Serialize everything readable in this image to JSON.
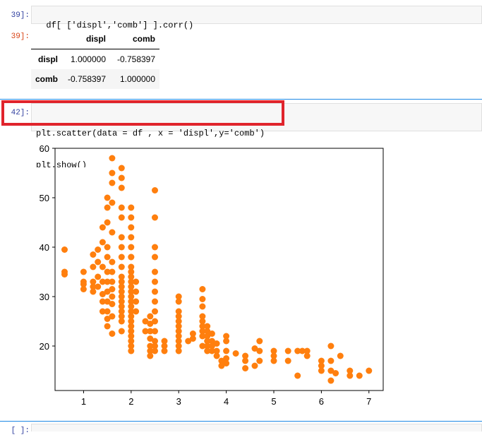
{
  "cells": [
    {
      "in_prompt": "39]:",
      "code": "df[ ['displ','comb'] ].corr()",
      "out_prompt": "39]:"
    },
    {
      "in_prompt": "42]:",
      "code_line1": "plt.scatter(data = df , x = 'displ',y='comb')",
      "code_line2": "plt.show()"
    },
    {
      "in_prompt": "[ ]:"
    }
  ],
  "corr_table": {
    "columns": [
      "displ",
      "comb"
    ],
    "rows": [
      {
        "index": "displ",
        "values": [
          "1.000000",
          "-0.758397"
        ]
      },
      {
        "index": "comb",
        "values": [
          "-0.758397",
          "1.000000"
        ]
      }
    ]
  },
  "colors": {
    "marker": "#ff7f0e",
    "highlight_box": "#e0242c",
    "selection_line": "#1e88e5"
  },
  "chart_data": {
    "type": "scatter",
    "title": "",
    "xlabel": "",
    "ylabel": "",
    "xlim": [
      0.4,
      7.3
    ],
    "ylim": [
      11,
      60
    ],
    "xticks": [
      1,
      2,
      3,
      4,
      5,
      6,
      7
    ],
    "yticks": [
      20,
      30,
      40,
      50,
      60
    ],
    "x": [
      0.6,
      0.6,
      0.6,
      1.0,
      1.0,
      1.0,
      1.0,
      1.2,
      1.2,
      1.2,
      1.2,
      1.2,
      1.3,
      1.3,
      1.3,
      1.3,
      1.4,
      1.4,
      1.4,
      1.4,
      1.4,
      1.4,
      1.4,
      1.5,
      1.5,
      1.5,
      1.5,
      1.5,
      1.5,
      1.5,
      1.5,
      1.5,
      1.5,
      1.5,
      1.5,
      1.6,
      1.6,
      1.6,
      1.6,
      1.6,
      1.6,
      1.6,
      1.6,
      1.6,
      1.6,
      1.6,
      1.6,
      1.6,
      1.8,
      1.8,
      1.8,
      1.8,
      1.8,
      1.8,
      1.8,
      1.8,
      1.8,
      1.8,
      1.8,
      1.8,
      1.8,
      1.8,
      1.8,
      1.8,
      1.8,
      1.8,
      1.8,
      1.8,
      2.0,
      2.0,
      2.0,
      2.0,
      2.0,
      2.0,
      2.0,
      2.0,
      2.0,
      2.0,
      2.0,
      2.0,
      2.0,
      2.0,
      2.0,
      2.0,
      2.0,
      2.0,
      2.0,
      2.0,
      2.0,
      2.0,
      2.0,
      2.0,
      2.0,
      2.1,
      2.1,
      2.1,
      2.1,
      2.3,
      2.3,
      2.4,
      2.4,
      2.4,
      2.4,
      2.4,
      2.4,
      2.4,
      2.5,
      2.5,
      2.5,
      2.5,
      2.5,
      2.5,
      2.5,
      2.5,
      2.5,
      2.5,
      2.5,
      2.5,
      2.5,
      2.5,
      2.7,
      2.7,
      2.7,
      3.0,
      3.0,
      3.0,
      3.0,
      3.0,
      3.0,
      3.0,
      3.0,
      3.0,
      3.0,
      3.0,
      3.2,
      3.3,
      3.3,
      3.5,
      3.5,
      3.5,
      3.5,
      3.5,
      3.5,
      3.5,
      3.5,
      3.5,
      3.6,
      3.6,
      3.6,
      3.6,
      3.6,
      3.6,
      3.7,
      3.7,
      3.7,
      3.7,
      3.8,
      3.8,
      3.8,
      3.9,
      3.9,
      4.0,
      4.0,
      4.0,
      4.0,
      4.0,
      4.2,
      4.4,
      4.4,
      4.4,
      4.6,
      4.6,
      4.7,
      4.7,
      4.7,
      5.0,
      5.0,
      5.0,
      5.3,
      5.3,
      5.5,
      5.5,
      5.6,
      5.7,
      5.7,
      6.0,
      6.0,
      6.0,
      6.2,
      6.2,
      6.2,
      6.2,
      6.3,
      6.4,
      6.6,
      6.6,
      6.8,
      7.0
    ],
    "y": [
      39.5,
      35.0,
      34.5,
      35.0,
      33.0,
      31.5,
      32.5,
      38.5,
      36.0,
      33.0,
      32.0,
      31.0,
      39.5,
      37.0,
      34.0,
      32.0,
      44.0,
      41.0,
      36.0,
      33.0,
      30.5,
      29.0,
      27.0,
      50.0,
      48.0,
      45.0,
      40.0,
      38.0,
      35.0,
      33.0,
      31.0,
      29.0,
      27.0,
      25.5,
      24.0,
      58.0,
      55.0,
      53.0,
      49.0,
      43.0,
      37.0,
      35.0,
      33.0,
      31.5,
      30.0,
      28.5,
      26.0,
      22.5,
      56.0,
      54.0,
      52.0,
      48.0,
      46.0,
      42.0,
      40.0,
      38.0,
      36.0,
      34.0,
      33.0,
      32.0,
      31.0,
      30.0,
      29.0,
      28.0,
      27.0,
      26.0,
      25.0,
      23.0,
      48.0,
      46.0,
      42.0,
      40.0,
      38.0,
      36.0,
      35.0,
      34.0,
      33.0,
      32.0,
      31.0,
      30.0,
      29.0,
      28.0,
      27.0,
      26.0,
      25.0,
      24.0,
      23.0,
      22.0,
      21.0,
      20.0,
      19.0,
      38.0,
      44.0,
      33.0,
      31.0,
      29.0,
      27.0,
      25.0,
      23.0,
      26.0,
      24.5,
      23.0,
      21.5,
      20.0,
      19.0,
      18.0,
      51.5,
      46.0,
      40.0,
      38.0,
      35.0,
      33.0,
      31.0,
      29.0,
      27.0,
      25.0,
      23.0,
      21.0,
      20.0,
      19.0,
      21.0,
      20.0,
      19.0,
      30.0,
      29.0,
      27.0,
      26.0,
      25.0,
      24.0,
      23.0,
      22.0,
      21.0,
      20.0,
      19.0,
      21.0,
      22.5,
      21.5,
      31.5,
      29.5,
      28.0,
      26.0,
      25.0,
      24.0,
      23.0,
      22.0,
      20.0,
      24.0,
      23.0,
      22.0,
      21.0,
      20.0,
      19.0,
      22.5,
      21.0,
      20.0,
      19.0,
      20.5,
      19.0,
      18.0,
      17.0,
      16.0,
      22.0,
      21.0,
      19.0,
      17.5,
      16.5,
      18.5,
      18.0,
      17.0,
      15.5,
      19.5,
      16.0,
      21.0,
      19.0,
      17.0,
      19.0,
      18.0,
      17.0,
      19.0,
      17.0,
      19.0,
      14.0,
      19.0,
      19.0,
      18.0,
      17.0,
      16.0,
      15.0,
      20.0,
      17.0,
      15.0,
      13.0,
      14.5,
      18.0,
      15.0,
      14.0,
      14.0,
      15.0
    ]
  }
}
